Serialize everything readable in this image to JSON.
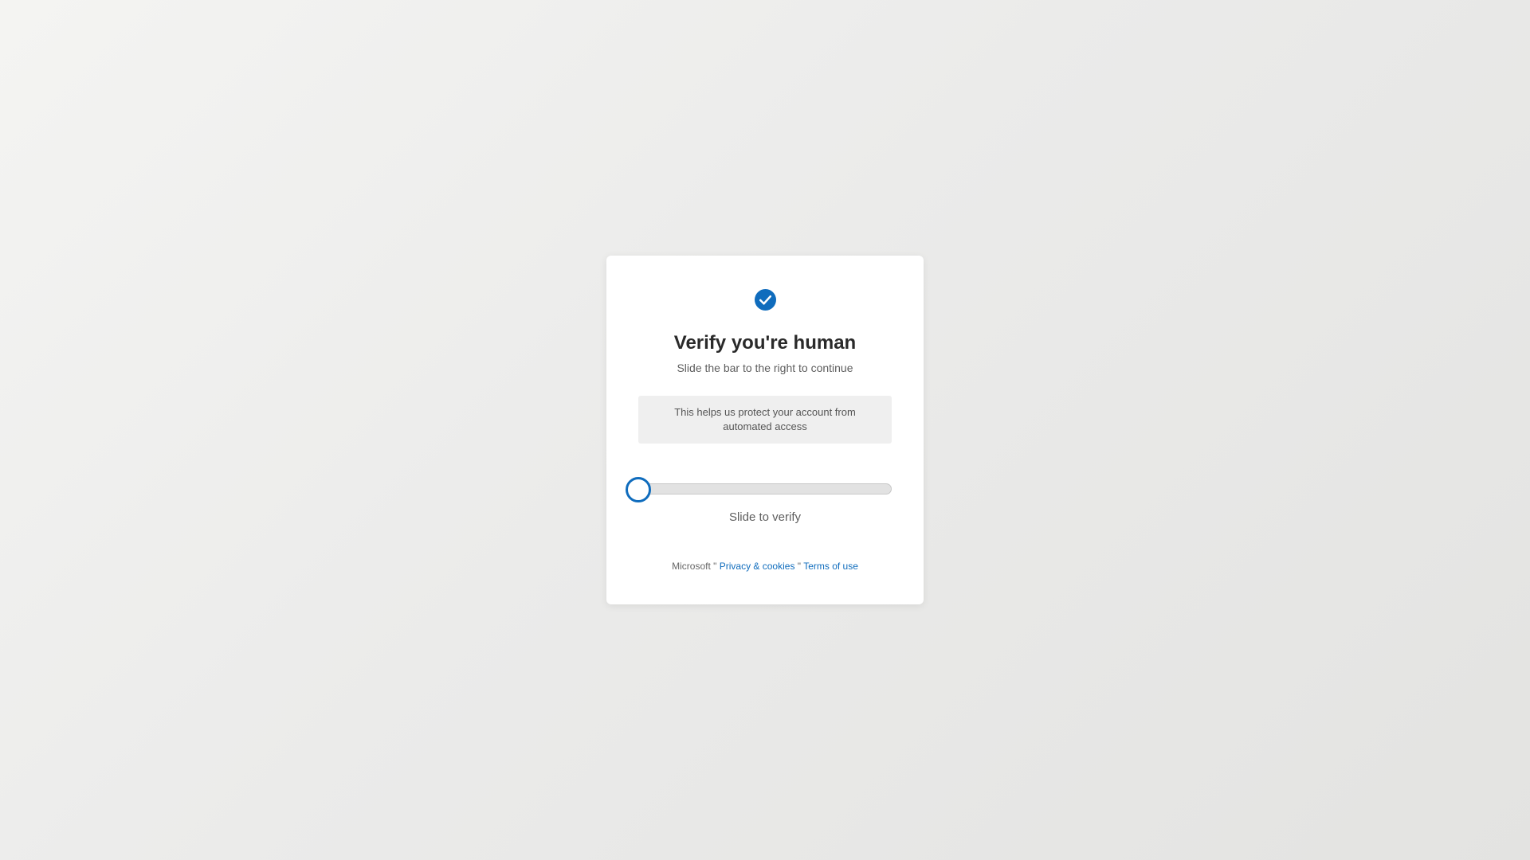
{
  "card": {
    "title": "Verify you're human",
    "subtitle": "Slide the bar to the right to continue",
    "info_text": "This helps us protect your account from automated access",
    "icon": "checkmark-circle-icon",
    "accent_color": "#0f6cbd"
  },
  "slider": {
    "label": "Slide to verify",
    "progress_percent": 0
  },
  "footer": {
    "brand": "Microsoft",
    "separator": "\"",
    "privacy_link": "Privacy & cookies",
    "terms_link": "Terms of use"
  }
}
